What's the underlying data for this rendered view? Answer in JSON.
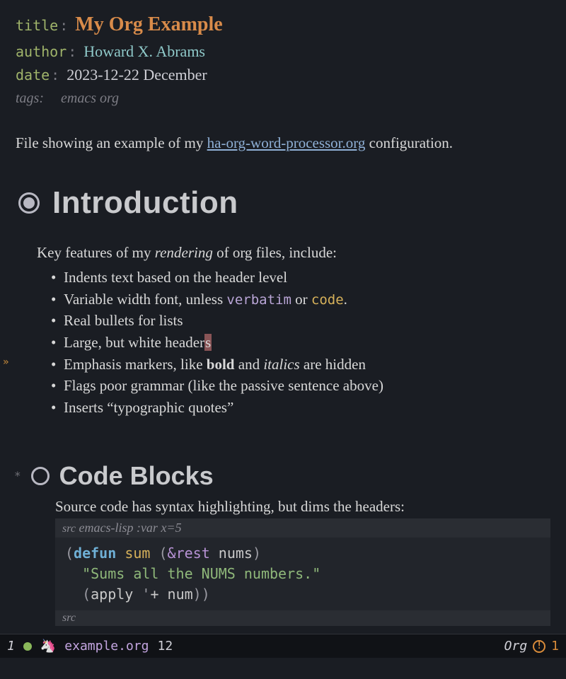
{
  "meta": {
    "title_key": "title",
    "title_value": "My Org Example",
    "author_key": "author",
    "author_value": "Howard X. Abrams",
    "date_key": "date",
    "date_value": "2023-12-22 December",
    "tags_key": "tags:",
    "tags_value": "emacs org"
  },
  "intro": {
    "before_link": "File showing an example of my ",
    "link_text": "ha-org-word-processor.org",
    "after_link": " configuration."
  },
  "sections": {
    "introduction": {
      "heading": "Introduction",
      "lead_before_em": "Key features of my ",
      "lead_em": "rendering",
      "lead_after_em": " of org files, include:",
      "bullets": {
        "b0": "Indents text based on the header level",
        "b1_a": "Variable width font, unless ",
        "b1_verb": "verbatim",
        "b1_b": " or ",
        "b1_code": "code",
        "b1_c": ".",
        "b2": "Real bullets for lists",
        "b3_a": "Large, but white header",
        "b3_cursor": "s",
        "b4_a": "Emphasis markers, like ",
        "b4_bold": "bold",
        "b4_b": " and ",
        "b4_italic": "italics",
        "b4_c": " are hidden",
        "b5": "Flags poor grammar (like the passive sentence above)",
        "b6": "Inserts “typographic quotes”"
      }
    },
    "code_blocks": {
      "heading": "Code Blocks",
      "intro": "Source code has syntax highlighting, but dims the headers:",
      "src_header_kw": "src",
      "src_header_rest": " emacs-lisp :var x=5",
      "code": {
        "l1_open": "(",
        "l1_defun": "defun",
        "l1_sp": " ",
        "l1_name": "sum",
        "l1_sp2": " ",
        "l1_po": "(",
        "l1_amp": "&rest",
        "l1_sp3": " ",
        "l1_arg": "nums",
        "l1_pc": ")",
        "l2_str": "\"Sums all the NUMS numbers.\"",
        "l3_open": "(",
        "l3_apply": "apply ",
        "l3_q": "'",
        "l3_plus": "+ ",
        "l3_num": "num",
        "l3_close": "))"
      },
      "src_footer": "src"
    }
  },
  "modeline": {
    "window_num": "1",
    "filename": "example.org",
    "line": "12",
    "mode": "Org",
    "warn_count": "1",
    "warn_glyph": "!"
  },
  "glyphs": {
    "unicorn": "🦄",
    "fringe_arrow": "»",
    "h2_star": "*"
  }
}
